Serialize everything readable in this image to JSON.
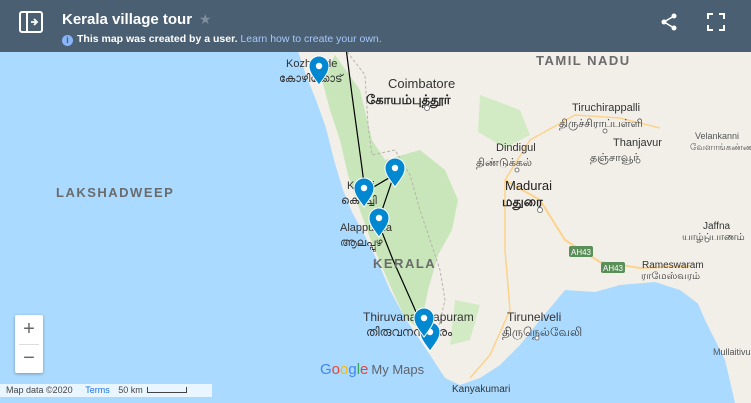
{
  "header": {
    "title": "Kerala village tour",
    "note": "This map was created by a user.",
    "note_link": "Learn how to create your own."
  },
  "map_labels": {
    "tamil_nadu": "TAMIL NADU",
    "lakshadweep": "LAKSHADWEEP",
    "kerala": "KERALA",
    "kozhikode": "Kozhikode",
    "kozhikode_ml": "കോഴിക്കോട്",
    "coimbatore": "Coimbatore",
    "coimbatore_ta": "கோயம்புத்தூர்",
    "tiruchirappalli": "Tiruchirappalli",
    "tiruchirappalli_ta": "திருச்சிராப்பள்ளி",
    "thanjavur": "Thanjavur",
    "thanjavur_ta": "தஞ்சாவூர்",
    "dindigul": "Dindigul",
    "dindigul_ta": "திண்டுக்கல்",
    "velankanni": "Velankanni",
    "velankanni_ta": "வேளாங்கண்ணி",
    "madurai": "Madurai",
    "madurai_ta": "மதுரை",
    "kochi": "Kochi",
    "kochi_ml": "കൊച്ചി",
    "alappuzha": "Alappuzha",
    "alappuzha_ml": "ആലപ്പുഴ",
    "jaffna": "Jaffna",
    "jaffna_ta": "யாழ்ப்பாணம்",
    "rameswaram": "Rameswaram",
    "rameswaram_ta": "ராமேஸ்வரம்",
    "thiruvananthapuram": "Thiruvananthapuram",
    "thiruvananthapuram_ml": "തിരുവനന്തപുരം",
    "tirunelveli": "Tirunelveli",
    "tirunelveli_ta": "திருநெல்வேலி",
    "kanyakumari": "Kanyakumari",
    "mullaitivu": "Mullaitivu",
    "ah43": "AH43"
  },
  "controls": {
    "zoom_in": "+",
    "zoom_out": "−"
  },
  "footer": {
    "map_data": "Map data ©2020",
    "terms": "Terms",
    "scale": "50 km"
  },
  "brand": {
    "google_g1": "G",
    "google_o1": "o",
    "google_o2": "o",
    "google_g2": "g",
    "google_l": "l",
    "google_e": "e",
    "my_maps": "My Maps"
  },
  "colors": {
    "water": "#aadaff",
    "land": "#f2efe9",
    "forest": "#c8e6b9",
    "header": "#4a5f72",
    "pin": "#0288d1",
    "route": "#000000"
  }
}
